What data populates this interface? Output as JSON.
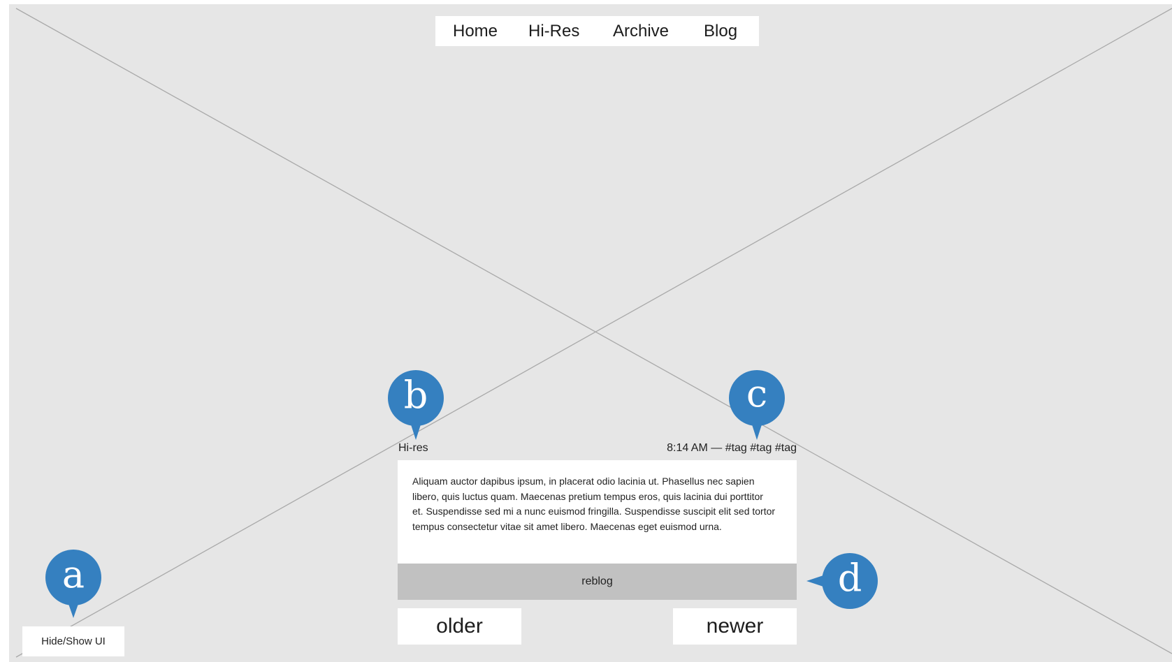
{
  "nav": {
    "items": [
      "Home",
      "Hi-Res",
      "Archive",
      "Blog"
    ]
  },
  "post": {
    "title": "Hi-res",
    "meta": "8:14 AM — #tag #tag #tag",
    "body": "Aliquam auctor dapibus ipsum, in placerat odio lacinia ut. Phasellus nec sapien libero, quis luctus quam. Maecenas pretium tempus eros, quis lacinia dui porttitor et. Suspendisse sed mi a nunc euismod fringilla. Suspendisse suscipit elit sed tortor tempus consectetur vitae sit amet libero. Maecenas eget euismod urna.",
    "reblog_label": "reblog"
  },
  "pager": {
    "older_label": "older",
    "newer_label": "newer"
  },
  "hide_show_label": "Hide/Show UI",
  "annotations": {
    "a": "a",
    "b": "b",
    "c": "c",
    "d": "d"
  },
  "colors": {
    "background": "#e6e6e6",
    "marker": "#3580c0",
    "reblog_bar": "#c1c1c1",
    "panel": "#ffffff"
  }
}
